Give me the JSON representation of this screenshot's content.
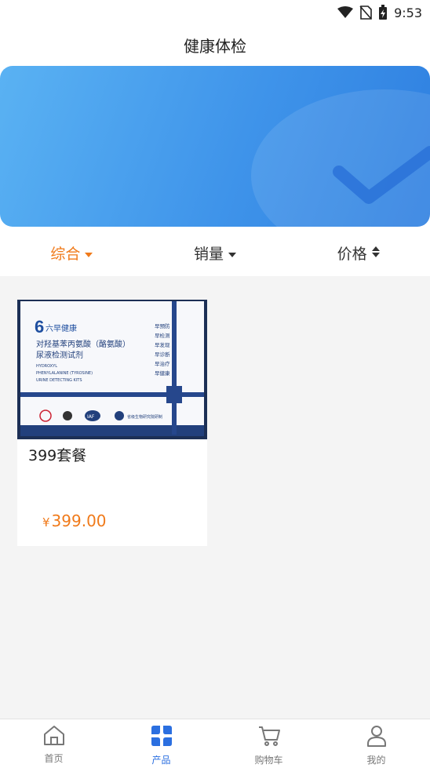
{
  "status": {
    "time": "9:53",
    "icons": [
      "wifi-icon",
      "no-sim-icon",
      "battery-charging-icon"
    ]
  },
  "header": {
    "title": "健康体检"
  },
  "filters": [
    {
      "label": "综合",
      "icon": "caret-down-icon",
      "active": true
    },
    {
      "label": "销量",
      "icon": "caret-down-icon",
      "active": false
    },
    {
      "label": "价格",
      "icon": "sort-icon",
      "active": false
    }
  ],
  "products": [
    {
      "name": "399套餐",
      "currency": "¥",
      "price": "399.00",
      "image": {
        "brand": "六早健康",
        "title": "对羟基苯丙氨酸（酪氨酸）",
        "subtitle": "尿液检测试剂",
        "en": [
          "HYDROXYL",
          "PHENYLALANINE (TYROSINE)",
          "URINE DETECTING KITS"
        ],
        "tags": [
          "早预防",
          "早检测",
          "早发现",
          "早诊断",
          "早治疗",
          "早健康"
        ],
        "badge": "IAF",
        "maker": "省级生物研究院研制"
      }
    }
  ],
  "tabs": [
    {
      "label": "首页",
      "icon": "home-icon",
      "active": false
    },
    {
      "label": "产品",
      "icon": "product-grid-icon",
      "active": true
    },
    {
      "label": "购物车",
      "icon": "cart-icon",
      "active": false
    },
    {
      "label": "我的",
      "icon": "user-icon",
      "active": false
    }
  ],
  "colors": {
    "accent": "#f07a1a",
    "primary": "#2b6fe0",
    "banner": "#3f94ea"
  }
}
